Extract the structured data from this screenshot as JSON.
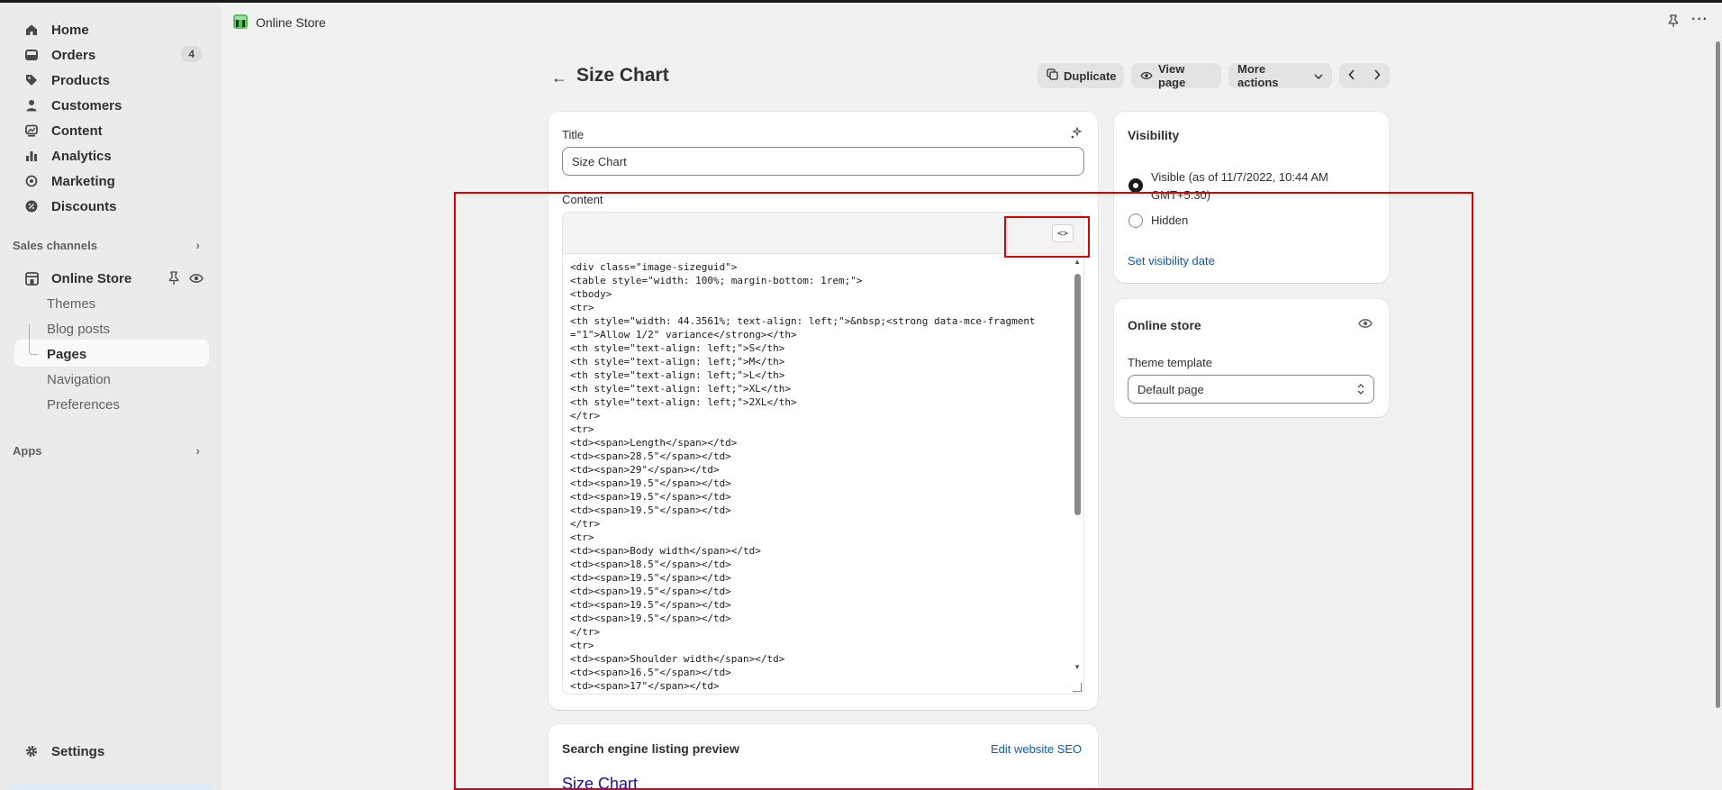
{
  "topbar": {
    "app_title": "Online Store"
  },
  "sidebar": {
    "items": [
      {
        "label": "Home",
        "icon": "home-icon"
      },
      {
        "label": "Orders",
        "icon": "orders-icon",
        "badge": "4"
      },
      {
        "label": "Products",
        "icon": "tag-icon"
      },
      {
        "label": "Customers",
        "icon": "person-icon"
      },
      {
        "label": "Content",
        "icon": "content-icon"
      },
      {
        "label": "Analytics",
        "icon": "chart-icon"
      },
      {
        "label": "Marketing",
        "icon": "target-icon"
      },
      {
        "label": "Discounts",
        "icon": "discount-icon"
      }
    ],
    "sales_channels_label": "Sales channels",
    "online_store_label": "Online Store",
    "sub_items": [
      "Themes",
      "Blog posts",
      "Pages",
      "Navigation",
      "Preferences"
    ],
    "apps_label": "Apps",
    "settings_label": "Settings"
  },
  "page": {
    "title": "Size Chart",
    "actions": {
      "duplicate": "Duplicate",
      "view_page": "View page",
      "more_actions": "More actions"
    }
  },
  "editor": {
    "title_label": "Title",
    "title_value": "Size Chart",
    "content_label": "Content",
    "code_toggle": "<>",
    "html_source": "<div class=\"image-sizeguid\">\n<table style=\"width: 100%; margin-bottom: 1rem;\">\n<tbody>\n<tr>\n<th style=\"width: 44.3561%; text-align: left;\">&nbsp;<strong data-mce-fragment=\"1\">Allow 1/2\" variance</strong></th>\n<th style=\"text-align: left;\">S</th>\n<th style=\"text-align: left;\">M</th>\n<th style=\"text-align: left;\">L</th>\n<th style=\"text-align: left;\">XL</th>\n<th style=\"text-align: left;\">2XL</th>\n</tr>\n<tr>\n<td><span>Length</span></td>\n<td><span>28.5\"</span></td>\n<td><span>29\"</span></td>\n<td><span>19.5\"</span></td>\n<td><span>19.5\"</span></td>\n<td><span>19.5\"</span></td>\n</tr>\n<tr>\n<td><span>Body width</span></td>\n<td><span>18.5\"</span></td>\n<td><span>19.5\"</span></td>\n<td><span>19.5\"</span></td>\n<td><span>19.5\"</span></td>\n<td><span>19.5\"</span></td>\n</tr>\n<tr>\n<td><span>Shoulder width</span></td>\n<td><span>16.5\"</span></td>\n<td><span>17\"</span></td>"
  },
  "seo": {
    "heading": "Search engine listing preview",
    "edit_link": "Edit website SEO",
    "preview_title": "Size Chart"
  },
  "visibility": {
    "heading": "Visibility",
    "visible_label": "Visible (as of 11/7/2022, 10:44 AM GMT+5:30)",
    "hidden_label": "Hidden",
    "set_date_link": "Set visibility date"
  },
  "online_store_card": {
    "heading": "Online store",
    "template_label": "Theme template",
    "template_value": "Default page"
  }
}
